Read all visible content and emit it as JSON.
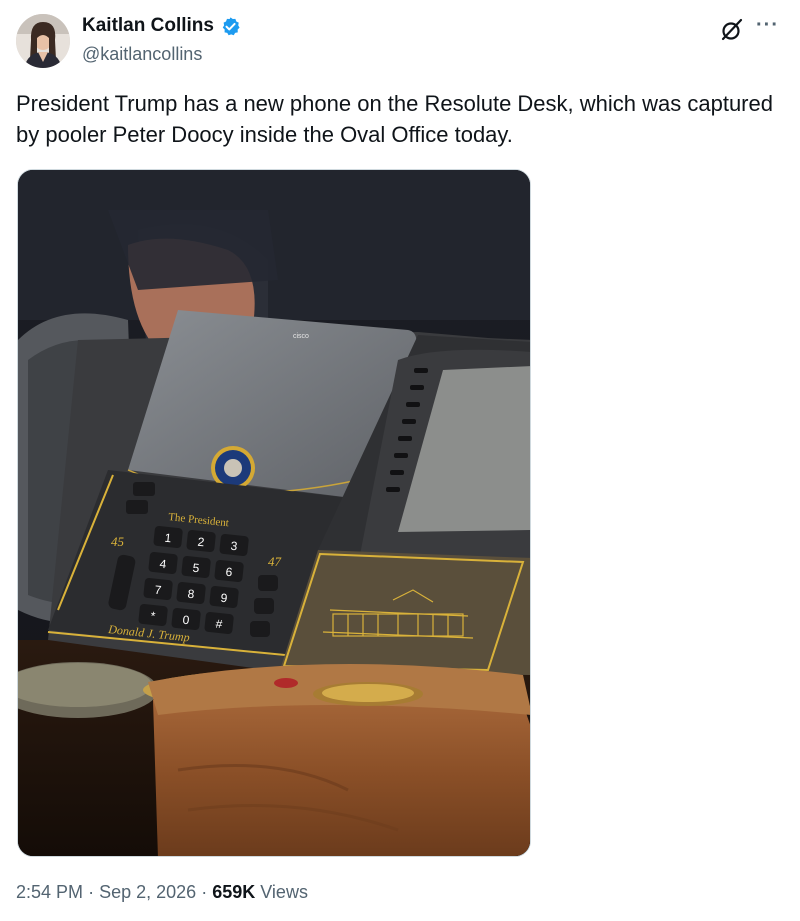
{
  "author": {
    "name": "Kaitlan Collins",
    "handle": "@kaitlancollins",
    "verified": true
  },
  "tweet": {
    "text": "President Trump has a new phone on the Resolute Desk, which was captured by pooler Peter Doocy inside the Oval Office today."
  },
  "media": {
    "phone_brand": "cisco",
    "phone_label": "The President",
    "phone_signature": "Donald J. Trump",
    "left_number": "45",
    "right_number": "47",
    "keys": [
      "1",
      "2",
      "3",
      "4",
      "5",
      "6",
      "7",
      "8",
      "9",
      "*",
      "0",
      "#"
    ]
  },
  "meta": {
    "time": "2:54 PM",
    "separator": "·",
    "date": "Sep 2, 2026",
    "views_count": "659K",
    "views_label": "Views"
  },
  "icons": {
    "verified": "verified-badge-icon",
    "grok": "grok-icon",
    "more": "more-icon"
  },
  "colors": {
    "verified_blue": "#1d9bf0",
    "secondary_text": "#536471",
    "gold": "#d9b23a"
  }
}
